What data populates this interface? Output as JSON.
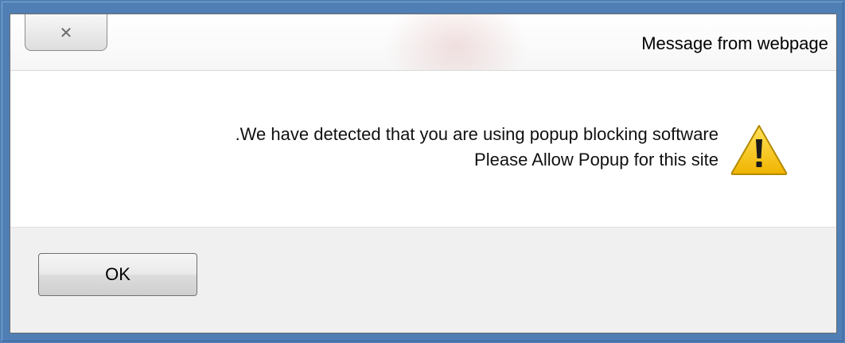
{
  "dialog": {
    "title": "Message from webpage",
    "close_glyph": "✕",
    "close_icon": "close-icon",
    "message_lines": [
      ".We have detected that you are using popup blocking software",
      "Please Allow Popup for this site"
    ],
    "warning_icon": "warning-icon",
    "ok_label": "OK"
  },
  "colors": {
    "desktop_background": "#4f7fb5",
    "content_background": "#ffffff",
    "footer_background": "#f0f0f0",
    "warning_fill": "#f5c400",
    "warning_mark": "#1a1a1a"
  }
}
